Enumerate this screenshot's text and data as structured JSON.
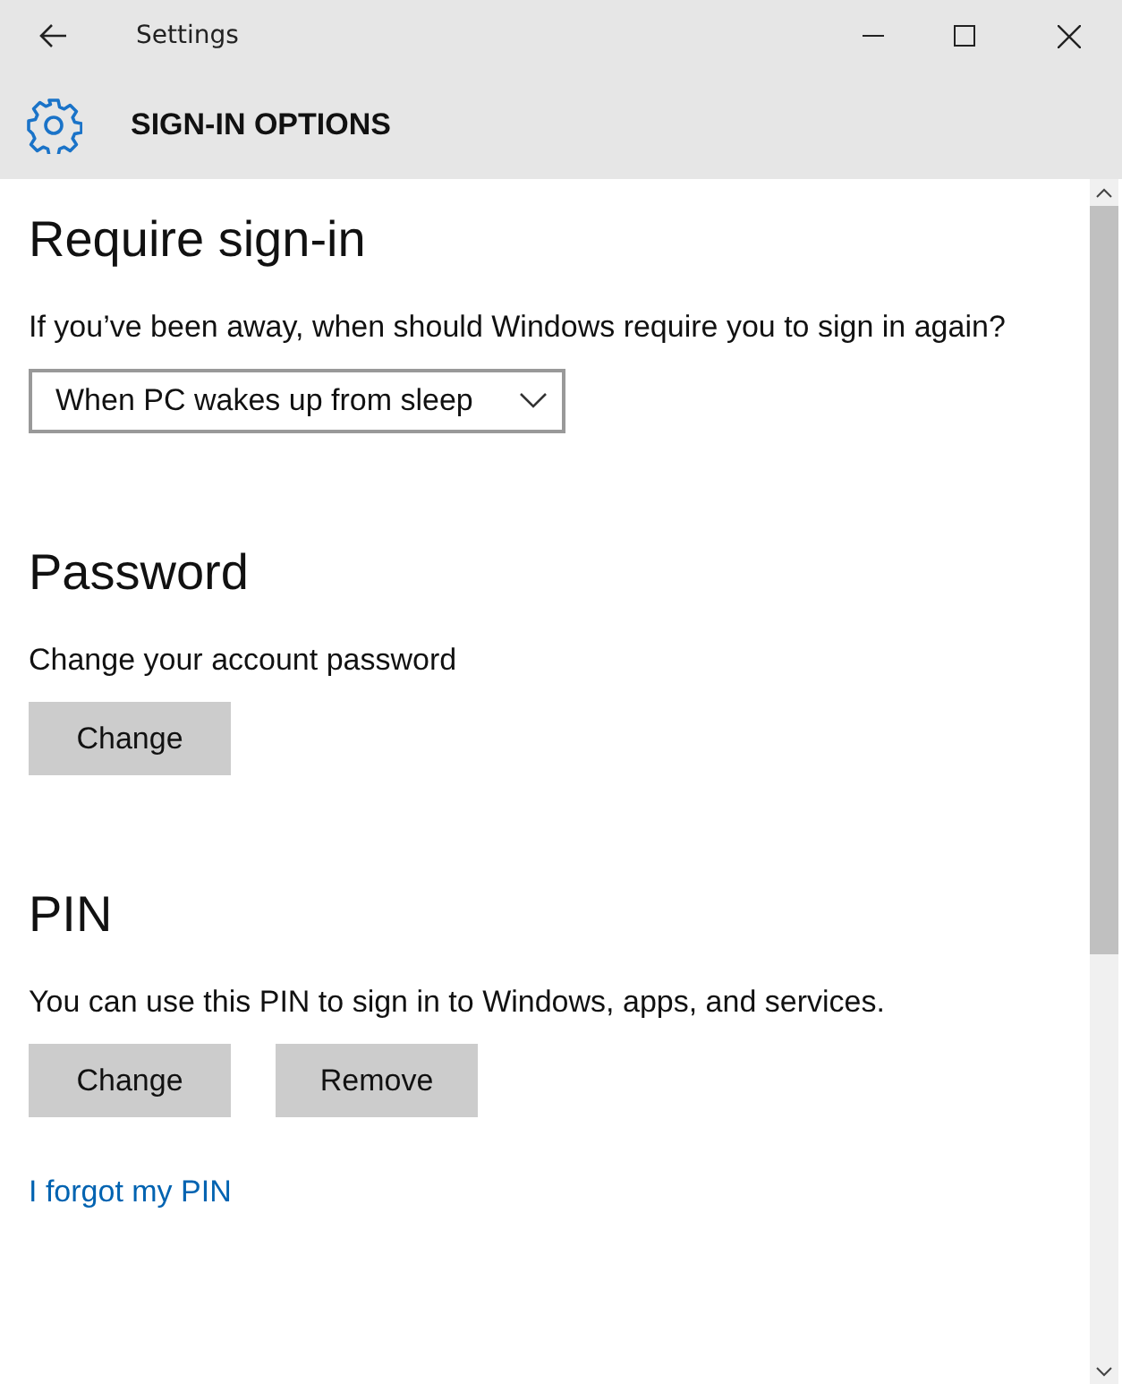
{
  "window": {
    "title": "Settings"
  },
  "page": {
    "title": "SIGN-IN OPTIONS"
  },
  "sections": [
    {
      "heading": "Require sign-in",
      "description": "If you’ve been away, when should Windows require you to sign in again?",
      "controls": [
        {
          "kind": "dropdown",
          "value": "When PC wakes up from sleep"
        }
      ]
    },
    {
      "heading": "Password",
      "description": "Change your account password",
      "controls": [
        {
          "kind": "button",
          "label": "Change"
        }
      ]
    },
    {
      "heading": "PIN",
      "description": "You can use this PIN to sign in to Windows, apps, and services.",
      "controls": [
        {
          "kind": "button",
          "label": "Change"
        },
        {
          "kind": "button",
          "label": "Remove"
        }
      ],
      "links": [
        "I forgot my PIN"
      ]
    }
  ]
}
